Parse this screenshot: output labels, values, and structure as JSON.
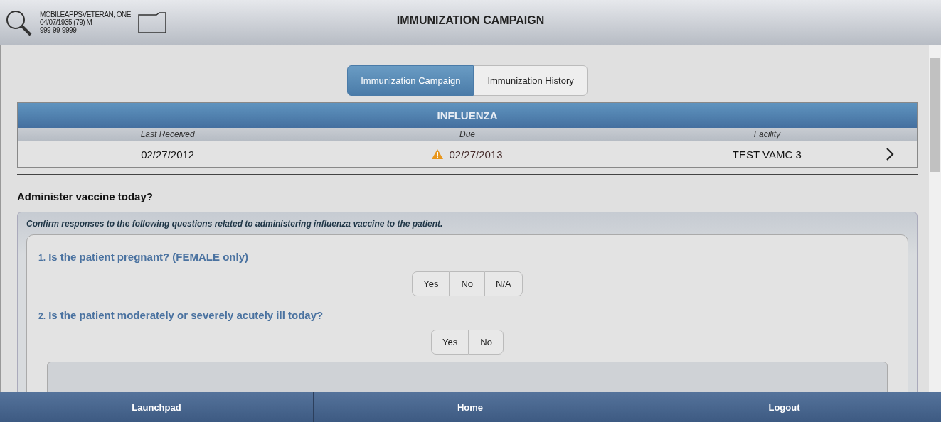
{
  "header": {
    "patient_name": "MOBILEAPPSVETERAN, ONE",
    "patient_dob": "04/07/1935 (79) M",
    "patient_ssn": "999-99-9999",
    "title": "IMMUNIZATION CAMPAIGN"
  },
  "tabs": [
    {
      "label": "Immunization Campaign",
      "selected": true
    },
    {
      "label": "Immunization History",
      "selected": false
    }
  ],
  "vaccine_table": {
    "title": "INFLUENZA",
    "columns": [
      "Last Received",
      "Due",
      "Facility"
    ],
    "row": {
      "last_received": "02/27/2012",
      "due": "02/27/2013",
      "due_warning": true,
      "facility": "TEST VAMC 3"
    }
  },
  "section_title": "Administer vaccine today?",
  "instructions": "Confirm responses to the following questions related to administering influenza vaccine to the patient.",
  "questions": [
    {
      "number": "1.",
      "text": "Is the patient pregnant? (FEMALE only)",
      "options": [
        {
          "label": "Yes",
          "selected": false
        },
        {
          "label": "No",
          "selected": false
        },
        {
          "label": "N/A",
          "selected": false
        }
      ]
    },
    {
      "number": "2.",
      "text": "Is the patient moderately or severely acutely ill today?",
      "options": [
        {
          "label": "Yes",
          "selected": false
        },
        {
          "label": "No",
          "selected": false
        }
      ]
    }
  ],
  "footer": [
    "Launchpad",
    "Home",
    "Logout"
  ]
}
